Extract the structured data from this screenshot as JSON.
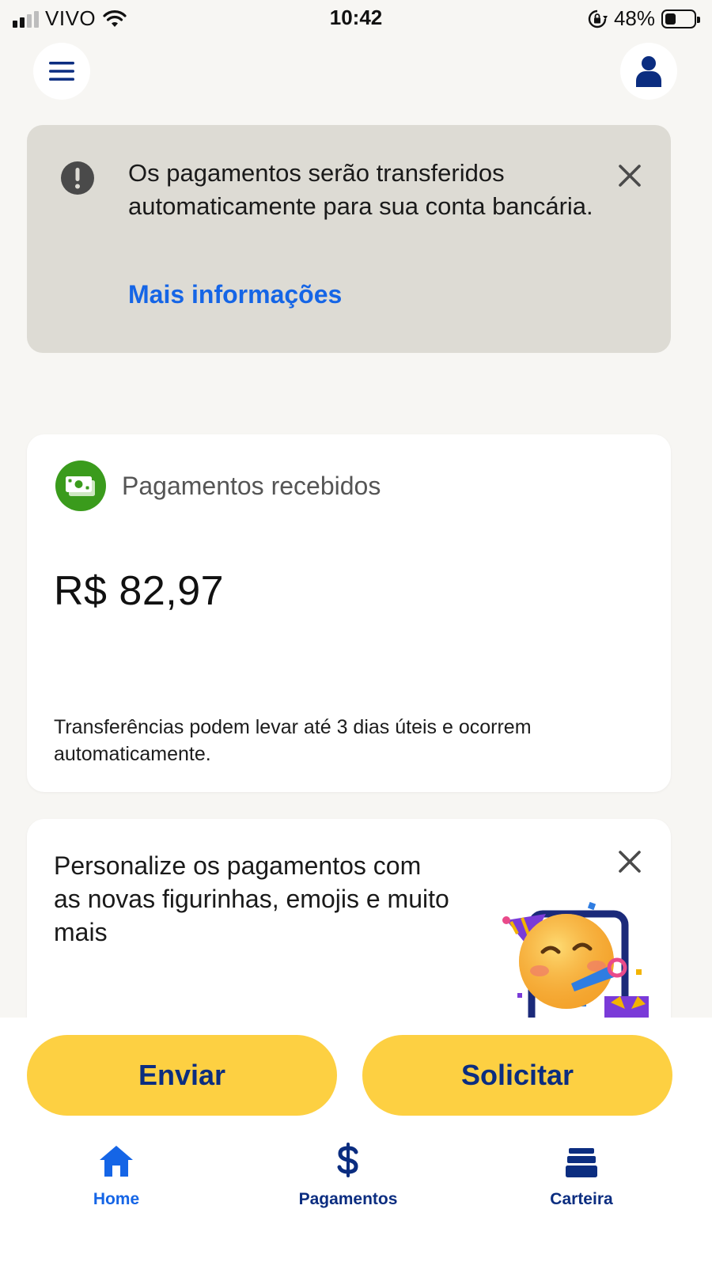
{
  "status_bar": {
    "carrier": "VIVO",
    "time": "10:42",
    "battery_percent": "48%",
    "battery_level": 0.48,
    "icons": [
      "signal-icon",
      "wifi-icon",
      "rotation-lock-icon",
      "battery-icon"
    ]
  },
  "header": {
    "icons": [
      "menu-icon",
      "profile-icon"
    ]
  },
  "notice": {
    "text": "Os pagamentos serão transferidos automaticamente para sua conta bancária.",
    "link": "Mais informações",
    "icons": [
      "alert-icon",
      "close-icon"
    ],
    "colors": {
      "background": "#dddbd4",
      "link": "#1565e6"
    }
  },
  "payments_card": {
    "title": "Pagamentos recebidos",
    "amount": "R$ 82,97",
    "note": "Transferências podem levar até 3 dias úteis e ocorrem automaticamente.",
    "icon": "money-icon",
    "colors": {
      "icon_bg": "#3a9b1c"
    }
  },
  "promo_card": {
    "text": "Personalize os pagamentos com as novas figurinhas, emojis e muito mais",
    "icons": [
      "close-icon",
      "party-emoji-icon"
    ]
  },
  "actions": {
    "send_label": "Enviar",
    "request_label": "Solicitar",
    "colors": {
      "button_bg": "#fdd042",
      "button_text": "#0b2d80"
    }
  },
  "tabbar": {
    "items": [
      {
        "label": "Home",
        "icon": "home-icon",
        "active": true
      },
      {
        "label": "Pagamentos",
        "icon": "dollar-icon",
        "active": false
      },
      {
        "label": "Carteira",
        "icon": "wallet-icon",
        "active": false
      }
    ],
    "colors": {
      "active": "#1565e6",
      "inactive": "#0b2d80"
    }
  }
}
